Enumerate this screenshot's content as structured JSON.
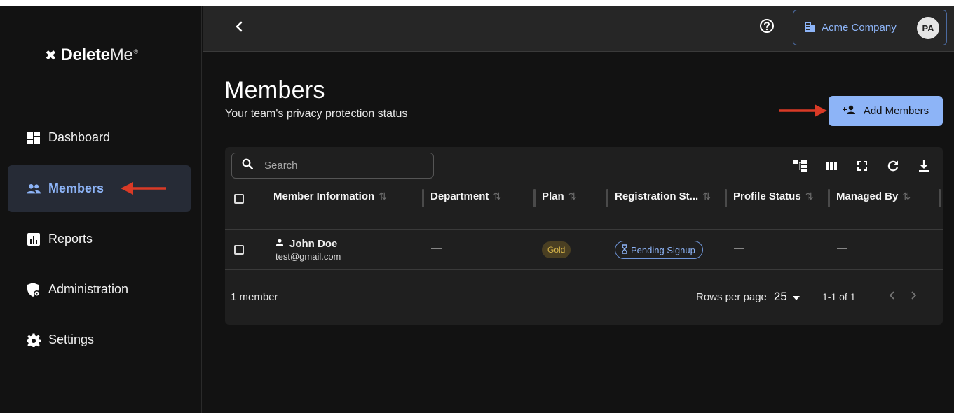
{
  "app": {
    "logo_mark": "✖",
    "logo_bold": "Delete",
    "logo_light": "Me",
    "logo_tm": "®"
  },
  "sidebar": {
    "items": [
      {
        "label": "Dashboard",
        "icon": "dashboard-icon",
        "active": false
      },
      {
        "label": "Members",
        "icon": "members-icon",
        "active": true
      },
      {
        "label": "Reports",
        "icon": "reports-icon",
        "active": false
      },
      {
        "label": "Administration",
        "icon": "administration-icon",
        "active": false
      },
      {
        "label": "Settings",
        "icon": "gear-icon",
        "active": false
      }
    ]
  },
  "topbar": {
    "company_name": "Acme Company",
    "avatar_initials": "PA"
  },
  "page": {
    "title": "Members",
    "subtitle": "Your team's privacy protection status",
    "add_button_label": "Add Members"
  },
  "table": {
    "search_placeholder": "Search",
    "columns": [
      "Member Information",
      "Department",
      "Plan",
      "Registration St...",
      "Profile Status",
      "Managed By"
    ],
    "rows": [
      {
        "name": "John Doe",
        "email": "test@gmail.com",
        "department": "—",
        "plan": "Gold",
        "registration_status": "Pending Signup",
        "profile_status": "—",
        "managed_by": "—"
      }
    ],
    "footer": {
      "member_count": "1 member",
      "rows_per_page_label": "Rows per page",
      "rows_per_page_value": "25",
      "range": "1-1 of 1"
    }
  },
  "colors": {
    "accent": "#8db4f7",
    "background": "#121212",
    "annotation_arrow": "#d93a26",
    "gold_badge_bg": "#4a3f22",
    "gold_badge_text": "#d8b64a"
  }
}
